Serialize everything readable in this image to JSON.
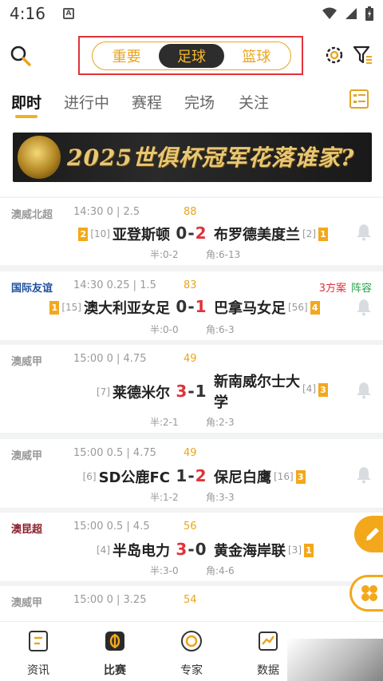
{
  "status": {
    "time": "4:16",
    "notif_icon": "a-letter-icon",
    "icons": [
      "wifi-icon",
      "signal-icon",
      "battery-icon"
    ]
  },
  "topbar": {
    "segments": [
      "重要",
      "足球",
      "篮球"
    ],
    "active_segment": "足球",
    "accent": "#e9a520",
    "highlight_box_color": "#e0333a"
  },
  "tabs": [
    "即时",
    "进行中",
    "赛程",
    "完场",
    "关注"
  ],
  "banner": {
    "text": "2025世俱杯冠军花落谁家?"
  },
  "matches": [
    {
      "league": "澳威北超",
      "league_color": "#999999",
      "time": "14:30",
      "odds": "0 | 2.5",
      "minute": "88",
      "home": "亚登斯顿",
      "home_card": "2",
      "home_rank": "[10]",
      "score_home": "0",
      "score_away": "2",
      "away": "布罗德美度兰",
      "away_rank": "[2]",
      "away_card": "1",
      "half": "半:0-2",
      "corners": "角:6-13"
    },
    {
      "league": "国际友谊",
      "league_color": "#1f4f9c",
      "time": "14:30",
      "odds": "0.25 | 1.5",
      "minute": "83",
      "extra_a": "3方案",
      "extra_b": "阵容",
      "home": "澳大利亚女足",
      "home_card": "1",
      "home_rank": "[15]",
      "score_home": "0",
      "score_away": "1",
      "away": "巴拿马女足",
      "away_rank": "[56]",
      "away_card": "4",
      "half": "半:0-0",
      "corners": "角:6-3"
    },
    {
      "league": "澳威甲",
      "league_color": "#999999",
      "time": "15:00",
      "odds": "0 | 4.75",
      "minute": "49",
      "home": "莱德米尔",
      "home_rank": "[7]",
      "score_home": "3",
      "score_away": "1",
      "away_line1": "新南威尔士大",
      "away_line2": "学",
      "away_rank": "[4]",
      "away_card": "3",
      "half": "半:2-1",
      "corners": "角:2-3"
    },
    {
      "league": "澳威甲",
      "league_color": "#999999",
      "time": "15:00",
      "odds": "0.5 | 4.75",
      "minute": "49",
      "home": "SD公鹿FC",
      "home_rank": "[6]",
      "score_home": "1",
      "score_away": "2",
      "away": "保尼白鹰",
      "away_rank": "[16]",
      "away_card": "3",
      "half": "半:1-2",
      "corners": "角:3-3"
    },
    {
      "league": "澳昆超",
      "league_color": "#8a1f2a",
      "time": "15:00",
      "odds": "0.5 | 4.5",
      "minute": "56",
      "home": "半岛电力",
      "home_rank": "[4]",
      "score_home": "3",
      "score_away": "0",
      "away": "黄金海岸联",
      "away_rank": "[3]",
      "away_card": "1",
      "half": "半:3-0",
      "corners": "角:4-6"
    },
    {
      "league": "澳威甲",
      "league_color": "#999999",
      "time": "15:00",
      "odds": "0 | 3.25",
      "minute": "54"
    }
  ],
  "bottom_nav": [
    "资讯",
    "比赛",
    "专家",
    "数据"
  ],
  "bottom_nav_active": "比赛"
}
